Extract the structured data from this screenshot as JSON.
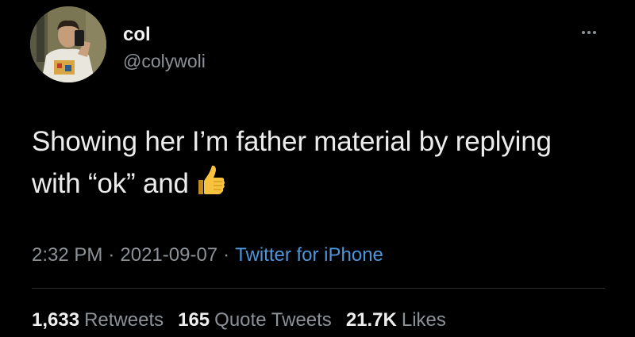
{
  "author": {
    "name": "col",
    "handle": "@colywoli",
    "avatar_icon": "profile-photo"
  },
  "menu_icon": "more-icon",
  "tweet": {
    "text": "Showing her I’m father material by replying with “ok” and",
    "emoji": "thumbs-up"
  },
  "meta": {
    "time": "2:32 PM",
    "date": "2021-09-07",
    "separator": "·",
    "source": "Twitter for iPhone"
  },
  "stats": {
    "retweets_count": "1,633",
    "retweets_label": "Retweets",
    "quotes_count": "165",
    "quotes_label": "Quote Tweets",
    "likes_count": "21.7K",
    "likes_label": "Likes"
  },
  "colors": {
    "background": "#000000",
    "text": "#ececec",
    "secondary": "#8b9196",
    "link": "#4d95d8"
  }
}
